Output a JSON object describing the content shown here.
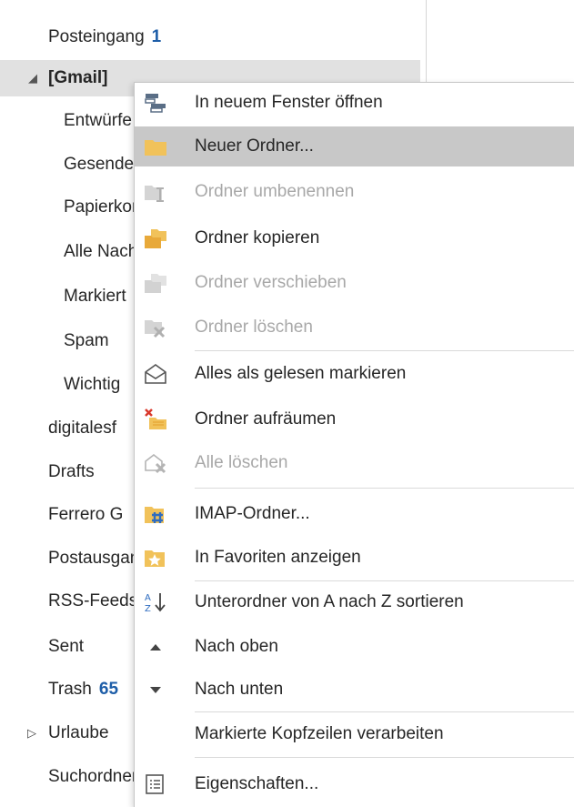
{
  "folders": [
    {
      "label": "Posteingang",
      "count": "1"
    },
    {
      "label": "[Gmail]",
      "expanded": true
    },
    {
      "label": "Entwürfe"
    },
    {
      "label": "Gesendet"
    },
    {
      "label": "Papierkorb"
    },
    {
      "label": "Alle Nachrichten"
    },
    {
      "label": "Markiert"
    },
    {
      "label": "Spam"
    },
    {
      "label": "Wichtig"
    },
    {
      "label": "digitalesf"
    },
    {
      "label": "Drafts"
    },
    {
      "label": "Ferrero G"
    },
    {
      "label": "Postausgang"
    },
    {
      "label": "RSS-Feeds"
    },
    {
      "label": "Sent"
    },
    {
      "label": "Trash",
      "count": "65"
    },
    {
      "label": "Urlaube",
      "collapsed": true
    },
    {
      "label": "Suchordner"
    }
  ],
  "menu": {
    "items": [
      {
        "label": "In neuem Fenster öffnen",
        "icon": "new-window-icon",
        "enabled": true
      },
      {
        "label": "Neuer Ordner...",
        "icon": "folder-icon",
        "enabled": true,
        "highlighted": true
      },
      {
        "label": "Ordner umbenennen",
        "icon": "rename-folder-icon",
        "enabled": false
      },
      {
        "label": "Ordner kopieren",
        "icon": "copy-folder-icon",
        "enabled": true
      },
      {
        "label": "Ordner verschieben",
        "icon": "move-folder-icon",
        "enabled": false
      },
      {
        "label": "Ordner löschen",
        "icon": "delete-folder-icon",
        "enabled": false
      },
      {
        "label": "Alles als gelesen markieren",
        "icon": "open-envelope-icon",
        "enabled": true
      },
      {
        "label": "Ordner aufräumen",
        "icon": "clean-up-folder-icon",
        "enabled": true
      },
      {
        "label": "Alle löschen",
        "icon": "delete-all-icon",
        "enabled": false
      },
      {
        "label": "IMAP-Ordner...",
        "icon": "imap-folder-icon",
        "enabled": true
      },
      {
        "label": "In Favoriten anzeigen",
        "icon": "favorite-folder-icon",
        "enabled": true
      },
      {
        "label": "Unterordner von A nach Z sortieren",
        "icon": "sort-az-icon",
        "enabled": true
      },
      {
        "label": "Nach oben",
        "icon": "triangle-up-icon",
        "enabled": true
      },
      {
        "label": "Nach unten",
        "icon": "triangle-down-icon",
        "enabled": true
      },
      {
        "label": "Markierte Kopfzeilen verarbeiten",
        "icon": "",
        "enabled": true
      },
      {
        "label": "Eigenschaften...",
        "icon": "properties-icon",
        "enabled": true
      }
    ]
  },
  "colors": {
    "count_blue": "#1e5ea8",
    "menu_highlight": "#c8c8c8",
    "selected_folder": "#e1e1e1",
    "folder_yellow": "#f1c25a",
    "disabled_text": "#a8a8a8"
  }
}
